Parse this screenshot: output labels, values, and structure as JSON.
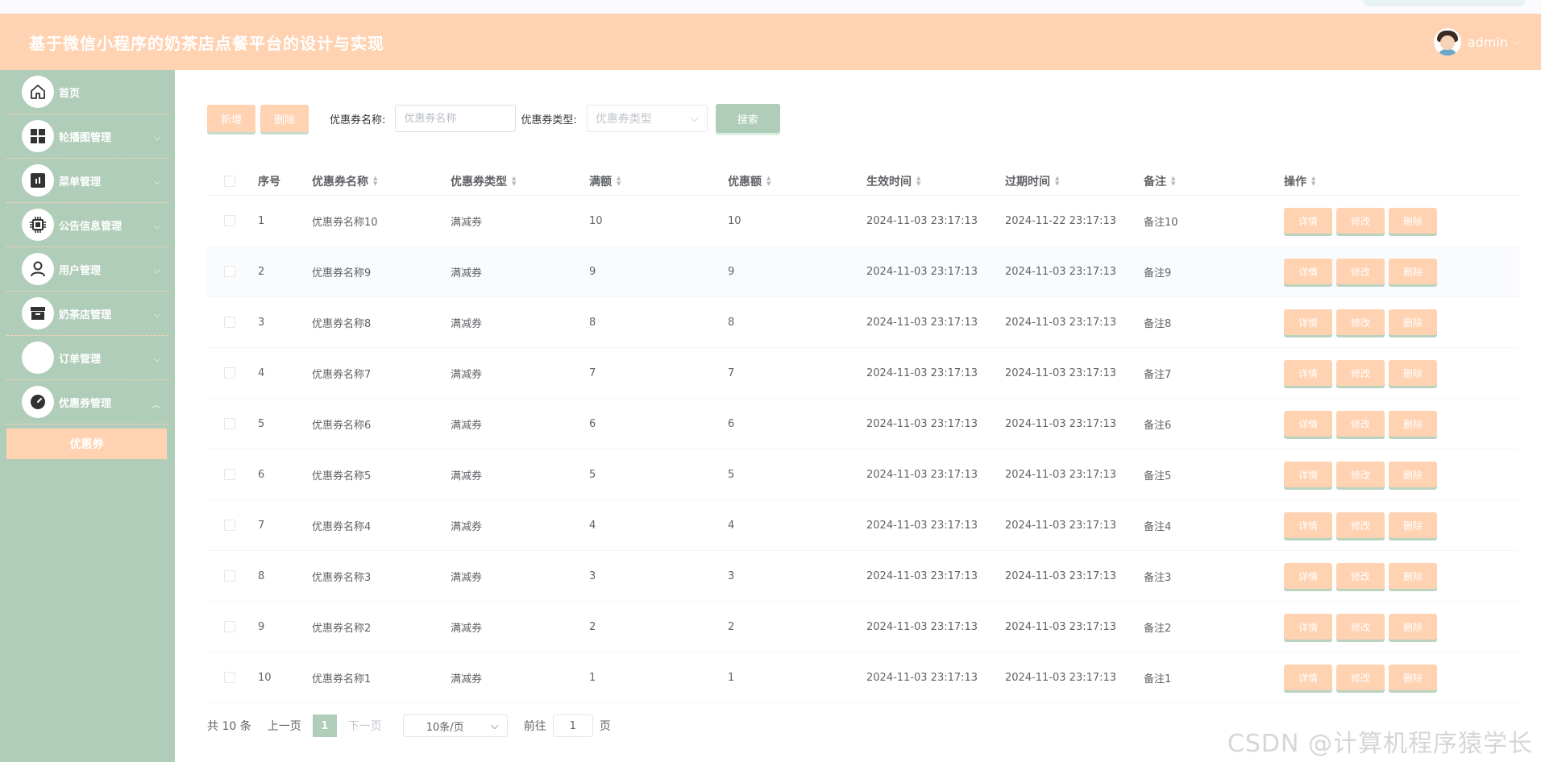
{
  "header": {
    "title": "基于微信小程序的奶茶店点餐平台的设计与实现",
    "username": "admin"
  },
  "sidebar": {
    "items": [
      {
        "label": "首页",
        "icon": "home-icon",
        "arrow": ""
      },
      {
        "label": "轮播图管理",
        "icon": "grid-icon",
        "arrow": "⌵"
      },
      {
        "label": "菜单管理",
        "icon": "chart-icon",
        "arrow": "⌵"
      },
      {
        "label": "公告信息管理",
        "icon": "chip-icon",
        "arrow": "⌵"
      },
      {
        "label": "用户管理",
        "icon": "user-icon",
        "arrow": "⌵"
      },
      {
        "label": "奶茶店管理",
        "icon": "box-icon",
        "arrow": "⌵"
      },
      {
        "label": "订单管理",
        "icon": "order-icon",
        "arrow": "⌵"
      },
      {
        "label": "优惠券管理",
        "icon": "gauge-icon",
        "arrow": "︿"
      }
    ],
    "submenu": {
      "label": "优惠券"
    }
  },
  "toolbar": {
    "add_label": "新增",
    "delete_label": "删除",
    "name_filter_label": "优惠券名称:",
    "name_placeholder": "优惠券名称",
    "type_filter_label": "优惠券类型:",
    "type_placeholder": "优惠券类型",
    "search_label": "搜索"
  },
  "table": {
    "headers": {
      "index": "序号",
      "name": "优惠券名称",
      "type": "优惠券类型",
      "full": "满额",
      "amount": "优惠额",
      "start": "生效时间",
      "end": "过期时间",
      "note": "备注",
      "ops": "操作"
    },
    "row_actions": {
      "detail": "详情",
      "edit": "修改",
      "delete": "删除"
    },
    "rows": [
      {
        "index": "1",
        "name": "优惠券名称10",
        "type": "满减券",
        "full": "10",
        "amount": "10",
        "start": "2024-11-03 23:17:13",
        "end": "2024-11-22 23:17:13",
        "note": "备注10"
      },
      {
        "index": "2",
        "name": "优惠券名称9",
        "type": "满减券",
        "full": "9",
        "amount": "9",
        "start": "2024-11-03 23:17:13",
        "end": "2024-11-03 23:17:13",
        "note": "备注9"
      },
      {
        "index": "3",
        "name": "优惠券名称8",
        "type": "满减券",
        "full": "8",
        "amount": "8",
        "start": "2024-11-03 23:17:13",
        "end": "2024-11-03 23:17:13",
        "note": "备注8"
      },
      {
        "index": "4",
        "name": "优惠券名称7",
        "type": "满减券",
        "full": "7",
        "amount": "7",
        "start": "2024-11-03 23:17:13",
        "end": "2024-11-03 23:17:13",
        "note": "备注7"
      },
      {
        "index": "5",
        "name": "优惠券名称6",
        "type": "满减券",
        "full": "6",
        "amount": "6",
        "start": "2024-11-03 23:17:13",
        "end": "2024-11-03 23:17:13",
        "note": "备注6"
      },
      {
        "index": "6",
        "name": "优惠券名称5",
        "type": "满减券",
        "full": "5",
        "amount": "5",
        "start": "2024-11-03 23:17:13",
        "end": "2024-11-03 23:17:13",
        "note": "备注5"
      },
      {
        "index": "7",
        "name": "优惠券名称4",
        "type": "满减券",
        "full": "4",
        "amount": "4",
        "start": "2024-11-03 23:17:13",
        "end": "2024-11-03 23:17:13",
        "note": "备注4"
      },
      {
        "index": "8",
        "name": "优惠券名称3",
        "type": "满减券",
        "full": "3",
        "amount": "3",
        "start": "2024-11-03 23:17:13",
        "end": "2024-11-03 23:17:13",
        "note": "备注3"
      },
      {
        "index": "9",
        "name": "优惠券名称2",
        "type": "满减券",
        "full": "2",
        "amount": "2",
        "start": "2024-11-03 23:17:13",
        "end": "2024-11-03 23:17:13",
        "note": "备注2"
      },
      {
        "index": "10",
        "name": "优惠券名称1",
        "type": "满减券",
        "full": "1",
        "amount": "1",
        "start": "2024-11-03 23:17:13",
        "end": "2024-11-03 23:17:13",
        "note": "备注1"
      }
    ]
  },
  "pagination": {
    "total": "共 10 条",
    "prev": "上一页",
    "current": "1",
    "next": "下一页",
    "page_size": "10条/页",
    "goto_label": "前往",
    "goto_value": "1",
    "page_unit": "页"
  },
  "watermark": "CSDN @计算机程序猿学长",
  "colors": {
    "header_bg": "#ffd2b1",
    "sidebar_bg": "#b0cdb9",
    "accent_peach": "#ffd2b1",
    "accent_green": "#b0cdb9"
  }
}
